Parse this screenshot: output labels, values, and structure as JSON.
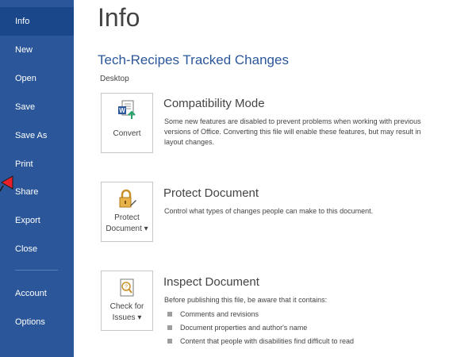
{
  "sidebar": {
    "items": [
      {
        "label": "Info",
        "active": true
      },
      {
        "label": "New"
      },
      {
        "label": "Open"
      },
      {
        "label": "Save"
      },
      {
        "label": "Save As"
      },
      {
        "label": "Print"
      },
      {
        "label": "Share"
      },
      {
        "label": "Export"
      },
      {
        "label": "Close"
      },
      {
        "label": "Account"
      },
      {
        "label": "Options"
      }
    ]
  },
  "main": {
    "page_title": "Info",
    "doc_title": "Tech-Recipes Tracked Changes",
    "doc_location": "Desktop",
    "sections": [
      {
        "button_label": "Convert",
        "icon": "word-convert-icon",
        "heading": "Compatibility Mode",
        "description": "Some new features are disabled to prevent problems when working with previous versions of Office. Converting this file will enable these features, but may result in layout changes."
      },
      {
        "button_label_line1": "Protect",
        "button_label_line2": "Document ▾",
        "icon": "lock-icon",
        "heading": "Protect Document",
        "description": "Control what types of changes people can make to this document."
      },
      {
        "button_label_line1": "Check for",
        "button_label_line2": "Issues ▾",
        "icon": "inspect-document-icon",
        "heading": "Inspect Document",
        "description": "Before publishing this file, be aware that it contains:",
        "bullets": [
          "Comments and revisions",
          "Document properties and author's name",
          "Content that people with disabilities find difficult to read"
        ]
      }
    ]
  },
  "colors": {
    "sidebar_bg": "#2b579a",
    "sidebar_active": "#19478a",
    "accent_title": "#2b579a",
    "cursor_red": "#e8202a"
  }
}
